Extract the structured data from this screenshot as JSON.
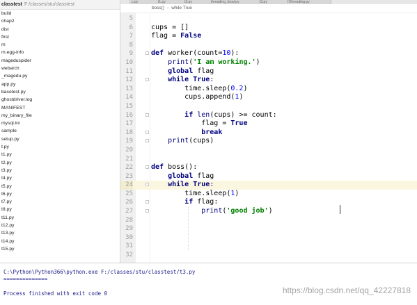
{
  "project": {
    "root_name": "classtest",
    "root_path": "F:/classes/stu/classtest",
    "files": [
      "build",
      "chap2",
      "dist",
      "first",
      "m",
      "m.egg-info",
      "mageduspider",
      "webarch",
      "_magedu.py",
      "app.py",
      "basetest.py",
      "ghostdriver.log",
      "MANIFEST",
      "my_binary_file",
      "mysql.ini",
      "sample",
      "setup.py",
      "t.py",
      "t1.py",
      "t2.py",
      "t3.py",
      "t4.py",
      "t5.py",
      "t6.py",
      "t7.py",
      "t8.py",
      "t11.py",
      "t12.py",
      "t13.py",
      "t14.py",
      "t15.py"
    ]
  },
  "editor": {
    "tabs": [
      {
        "label": "c.py"
      },
      {
        "label": "t1.py"
      },
      {
        "label": "t3.py"
      },
      {
        "label": "threading_local.py"
      },
      {
        "label": "t3.py"
      },
      {
        "label": "t7threading.py"
      }
    ],
    "breadcrumb": [
      "boss()",
      "while True"
    ],
    "current_line": 24,
    "lines": [
      {
        "num": "5",
        "text": "",
        "fold": false
      },
      {
        "num": "6",
        "text": "cups = []",
        "fold": false
      },
      {
        "num": "7",
        "text": "flag = False",
        "fold": false
      },
      {
        "num": "8",
        "text": "",
        "fold": false
      },
      {
        "num": "9",
        "text": "def worker(count=10):",
        "fold": true
      },
      {
        "num": "10",
        "text": "    print('I am working.')",
        "fold": false
      },
      {
        "num": "11",
        "text": "    global flag",
        "fold": false
      },
      {
        "num": "12",
        "text": "    while True:",
        "fold": true
      },
      {
        "num": "13",
        "text": "        time.sleep(0.2)",
        "fold": false
      },
      {
        "num": "14",
        "text": "        cups.append(1)",
        "fold": false
      },
      {
        "num": "15",
        "text": "",
        "fold": false
      },
      {
        "num": "16",
        "text": "        if len(cups) >= count:",
        "fold": true
      },
      {
        "num": "17",
        "text": "            flag = True",
        "fold": false
      },
      {
        "num": "18",
        "text": "            break",
        "fold": true
      },
      {
        "num": "19",
        "text": "    print(cups)",
        "fold": true
      },
      {
        "num": "20",
        "text": "",
        "fold": false
      },
      {
        "num": "21",
        "text": "",
        "fold": false
      },
      {
        "num": "22",
        "text": "def boss():",
        "fold": true
      },
      {
        "num": "23",
        "text": "    global flag",
        "fold": false
      },
      {
        "num": "24",
        "text": "    while True:",
        "fold": true
      },
      {
        "num": "25",
        "text": "        time.sleep(1)",
        "fold": false
      },
      {
        "num": "26",
        "text": "        if flag:",
        "fold": true
      },
      {
        "num": "27",
        "text": "            print('good job')",
        "fold": true
      },
      {
        "num": "28",
        "text": "",
        "fold": false
      },
      {
        "num": "29",
        "text": "",
        "fold": false
      },
      {
        "num": "30",
        "text": "",
        "fold": false
      },
      {
        "num": "31",
        "text": "",
        "fold": false
      },
      {
        "num": "32",
        "text": "",
        "fold": false
      }
    ]
  },
  "console": {
    "command": "C:\\Python\\Python366\\python.exe F:/classes/stu/classtest/t3.py",
    "output": "==============",
    "exit_message": "Process finished with exit code 0"
  },
  "watermark": "https://blog.csdn.net/qq_42227818",
  "colors": {
    "keyword": "#000080",
    "string": "#008000",
    "number": "#0000ff",
    "current_line": "#fbf6df"
  }
}
